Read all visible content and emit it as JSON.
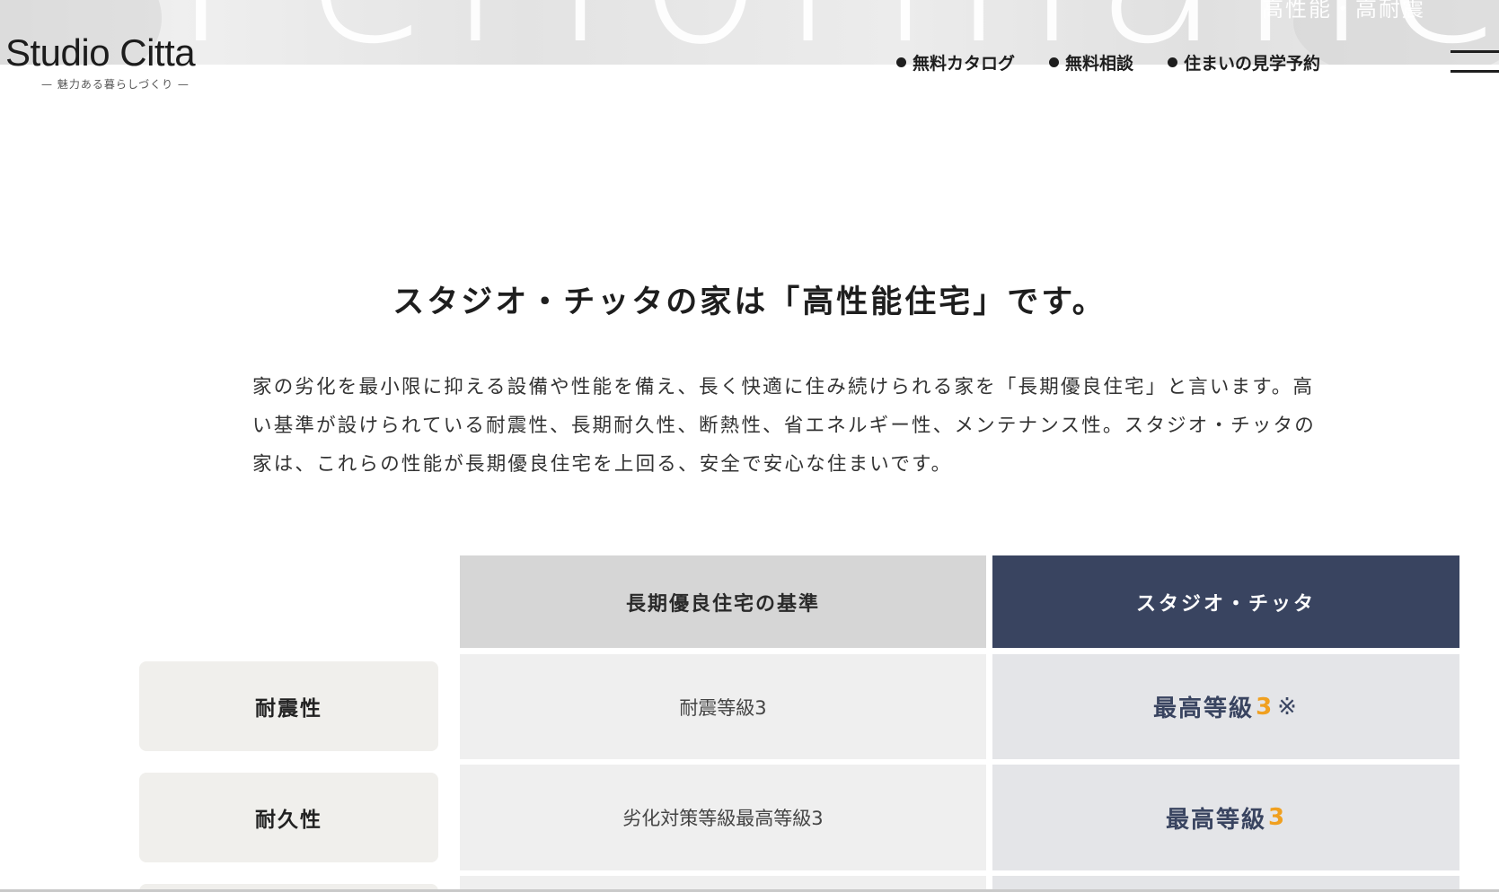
{
  "hero": {
    "background_word": "Performance",
    "tagline": "高性能・高耐震"
  },
  "logo": {
    "name": "Studio Citta",
    "tagline": "— 魅力ある暮らしづくり —"
  },
  "nav": {
    "items": [
      {
        "label": "無料カタログ"
      },
      {
        "label": "無料相談"
      },
      {
        "label": "住まいの見学予約"
      }
    ]
  },
  "headline": "スタジオ・チッタの家は「高性能住宅」です。",
  "intro": "家の劣化を最小限に抑える設備や性能を備え、長く快適に住み続けられる家を「長期優良住宅」と言います。高い基準が設けられている耐震性、長期耐久性、断熱性、省エネルギー性、メンテナンス性。スタジオ・チッタの家は、これらの性能が長期優良住宅を上回る、安全で安心な住まいです。",
  "table": {
    "headers": {
      "standard": "長期優良住宅の基準",
      "studio": "スタジオ・チッタ"
    },
    "rows": [
      {
        "label": "耐震性",
        "standard": "耐震等級3",
        "studio_text": "最高等級",
        "studio_value": "3",
        "studio_mark": "※"
      },
      {
        "label": "耐久性",
        "standard": "劣化対策等級最高等級3",
        "studio_text": "最高等級",
        "studio_value": "3",
        "studio_mark": ""
      }
    ]
  },
  "colors": {
    "navy": "#394460",
    "accent": "#f0a020",
    "header_grey": "#d6d6d6",
    "label_bg": "#f0efec"
  }
}
